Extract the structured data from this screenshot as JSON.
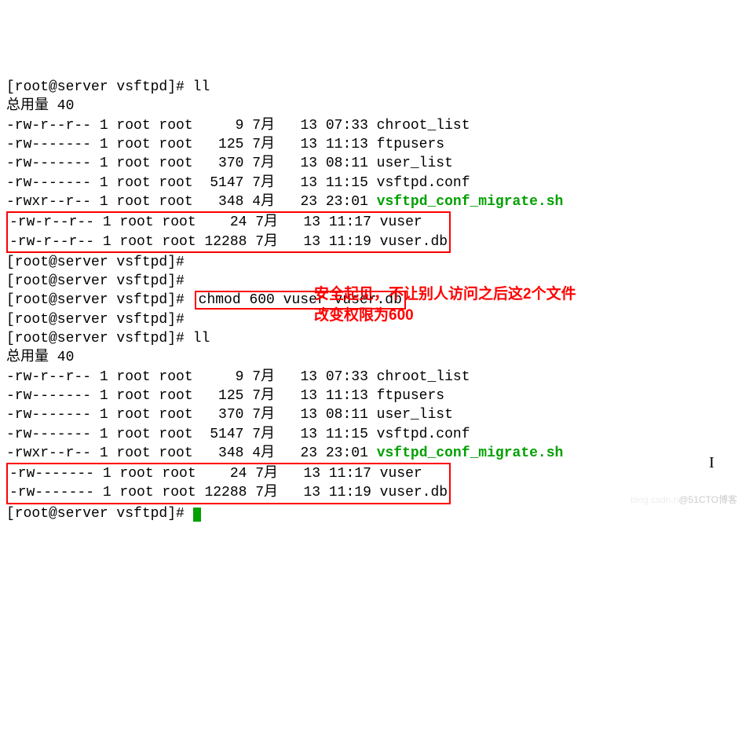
{
  "prompt": "[root@server vsftpd]#",
  "cmd_ll": "ll",
  "cmd_chmod": "chmod 600 vuser vuser.db",
  "total_label1": "总用量 40",
  "total_label2": "总用量 40",
  "listing1": [
    {
      "perm": "-rw-r--r--",
      "links": "1",
      "owner": "root",
      "group": "root",
      "size": "    9",
      "month": "7月",
      "day": "  13",
      "time": "07:33",
      "name": "chroot_list",
      "cls": ""
    },
    {
      "perm": "-rw-------",
      "links": "1",
      "owner": "root",
      "group": "root",
      "size": "  125",
      "month": "7月",
      "day": "  13",
      "time": "11:13",
      "name": "ftpusers",
      "cls": ""
    },
    {
      "perm": "-rw-------",
      "links": "1",
      "owner": "root",
      "group": "root",
      "size": "  370",
      "month": "7月",
      "day": "  13",
      "time": "08:11",
      "name": "user_list",
      "cls": ""
    },
    {
      "perm": "-rw-------",
      "links": "1",
      "owner": "root",
      "group": "root",
      "size": " 5147",
      "month": "7月",
      "day": "  13",
      "time": "11:15",
      "name": "vsftpd.conf",
      "cls": ""
    },
    {
      "perm": "-rwxr--r--",
      "links": "1",
      "owner": "root",
      "group": "root",
      "size": "  348",
      "month": "4月",
      "day": "  23",
      "time": "23:01",
      "name": "vsftpd_conf_migrate.sh",
      "cls": "exec"
    }
  ],
  "listing1_boxed": [
    {
      "perm": "-rw-r--r--",
      "links": "1",
      "owner": "root",
      "group": "root",
      "size": "   24",
      "month": "7月",
      "day": "  13",
      "time": "11:17",
      "name": "vuser",
      "cls": ""
    },
    {
      "perm": "-rw-r--r--",
      "links": "1",
      "owner": "root",
      "group": "root",
      "size": "12288",
      "month": "7月",
      "day": "  13",
      "time": "11:19",
      "name": "vuser.db",
      "cls": ""
    }
  ],
  "listing2": [
    {
      "perm": "-rw-r--r--",
      "links": "1",
      "owner": "root",
      "group": "root",
      "size": "    9",
      "month": "7月",
      "day": "  13",
      "time": "07:33",
      "name": "chroot_list",
      "cls": ""
    },
    {
      "perm": "-rw-------",
      "links": "1",
      "owner": "root",
      "group": "root",
      "size": "  125",
      "month": "7月",
      "day": "  13",
      "time": "11:13",
      "name": "ftpusers",
      "cls": ""
    },
    {
      "perm": "-rw-------",
      "links": "1",
      "owner": "root",
      "group": "root",
      "size": "  370",
      "month": "7月",
      "day": "  13",
      "time": "08:11",
      "name": "user_list",
      "cls": ""
    },
    {
      "perm": "-rw-------",
      "links": "1",
      "owner": "root",
      "group": "root",
      "size": " 5147",
      "month": "7月",
      "day": "  13",
      "time": "11:15",
      "name": "vsftpd.conf",
      "cls": ""
    },
    {
      "perm": "-rwxr--r--",
      "links": "1",
      "owner": "root",
      "group": "root",
      "size": "  348",
      "month": "4月",
      "day": "  23",
      "time": "23:01",
      "name": "vsftpd_conf_migrate.sh",
      "cls": "exec"
    }
  ],
  "listing2_boxed": [
    {
      "perm": "-rw-------",
      "links": "1",
      "owner": "root",
      "group": "root",
      "size": "   24",
      "month": "7月",
      "day": "  13",
      "time": "11:17",
      "name": "vuser",
      "cls": ""
    },
    {
      "perm": "-rw-------",
      "links": "1",
      "owner": "root",
      "group": "root",
      "size": "12288",
      "month": "7月",
      "day": "  13",
      "time": "11:19",
      "name": "vuser.db",
      "cls": ""
    }
  ],
  "annotation_line1": "安全起见，不让别人访问之后这2个文件",
  "annotation_line2": "改变权限为600",
  "watermark1": "blog.csdn.n",
  "watermark2": "@51CTO博客"
}
